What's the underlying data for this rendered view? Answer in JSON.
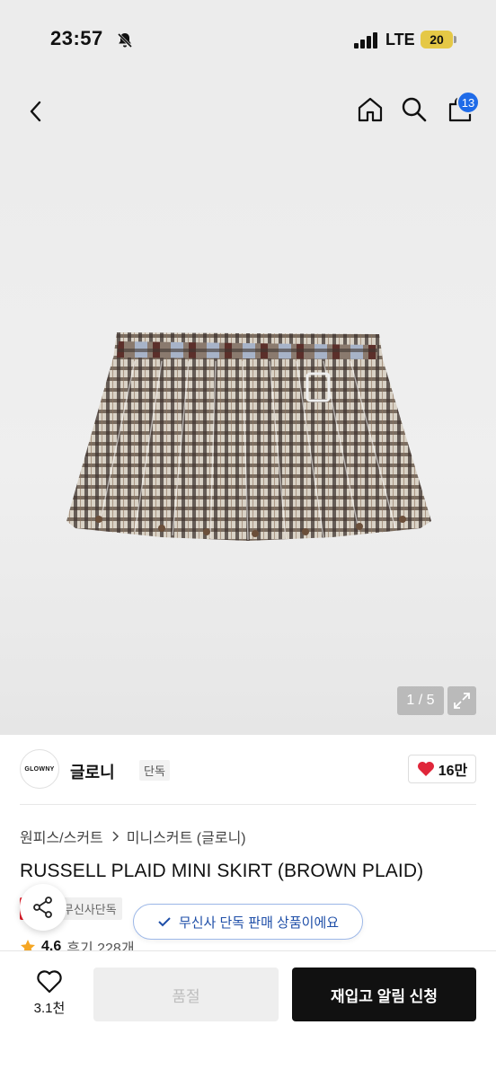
{
  "status_bar": {
    "time": "23:57",
    "network": "LTE",
    "battery": "20"
  },
  "nav": {
    "cart_count": "13"
  },
  "gallery": {
    "pager": "1 / 5"
  },
  "brand": {
    "logo_text": "GLOWNY",
    "name": "글로니",
    "tag": "단독",
    "likes": "16만"
  },
  "breadcrumb": [
    "원피스/스커트",
    "미니스커트 (글로니)"
  ],
  "product": {
    "title": "RUSSELL PLAID MINI SKIRT (BROWN PLAID)",
    "tags": [
      "세일",
      "무신사단독"
    ],
    "exclusive_notice": "무신사 단독 판매 상품이에요",
    "rating": "4.6",
    "reviews": "후기 228개"
  },
  "bottom": {
    "wish_count": "3.1천",
    "soldout_label": "품절",
    "restock_label": "재입고 알림 신청"
  },
  "colors": {
    "accent_blue": "#1f6be8",
    "sale_red": "#e11d2a",
    "heart_red": "#e0263a",
    "star_orange": "#f5a623"
  }
}
